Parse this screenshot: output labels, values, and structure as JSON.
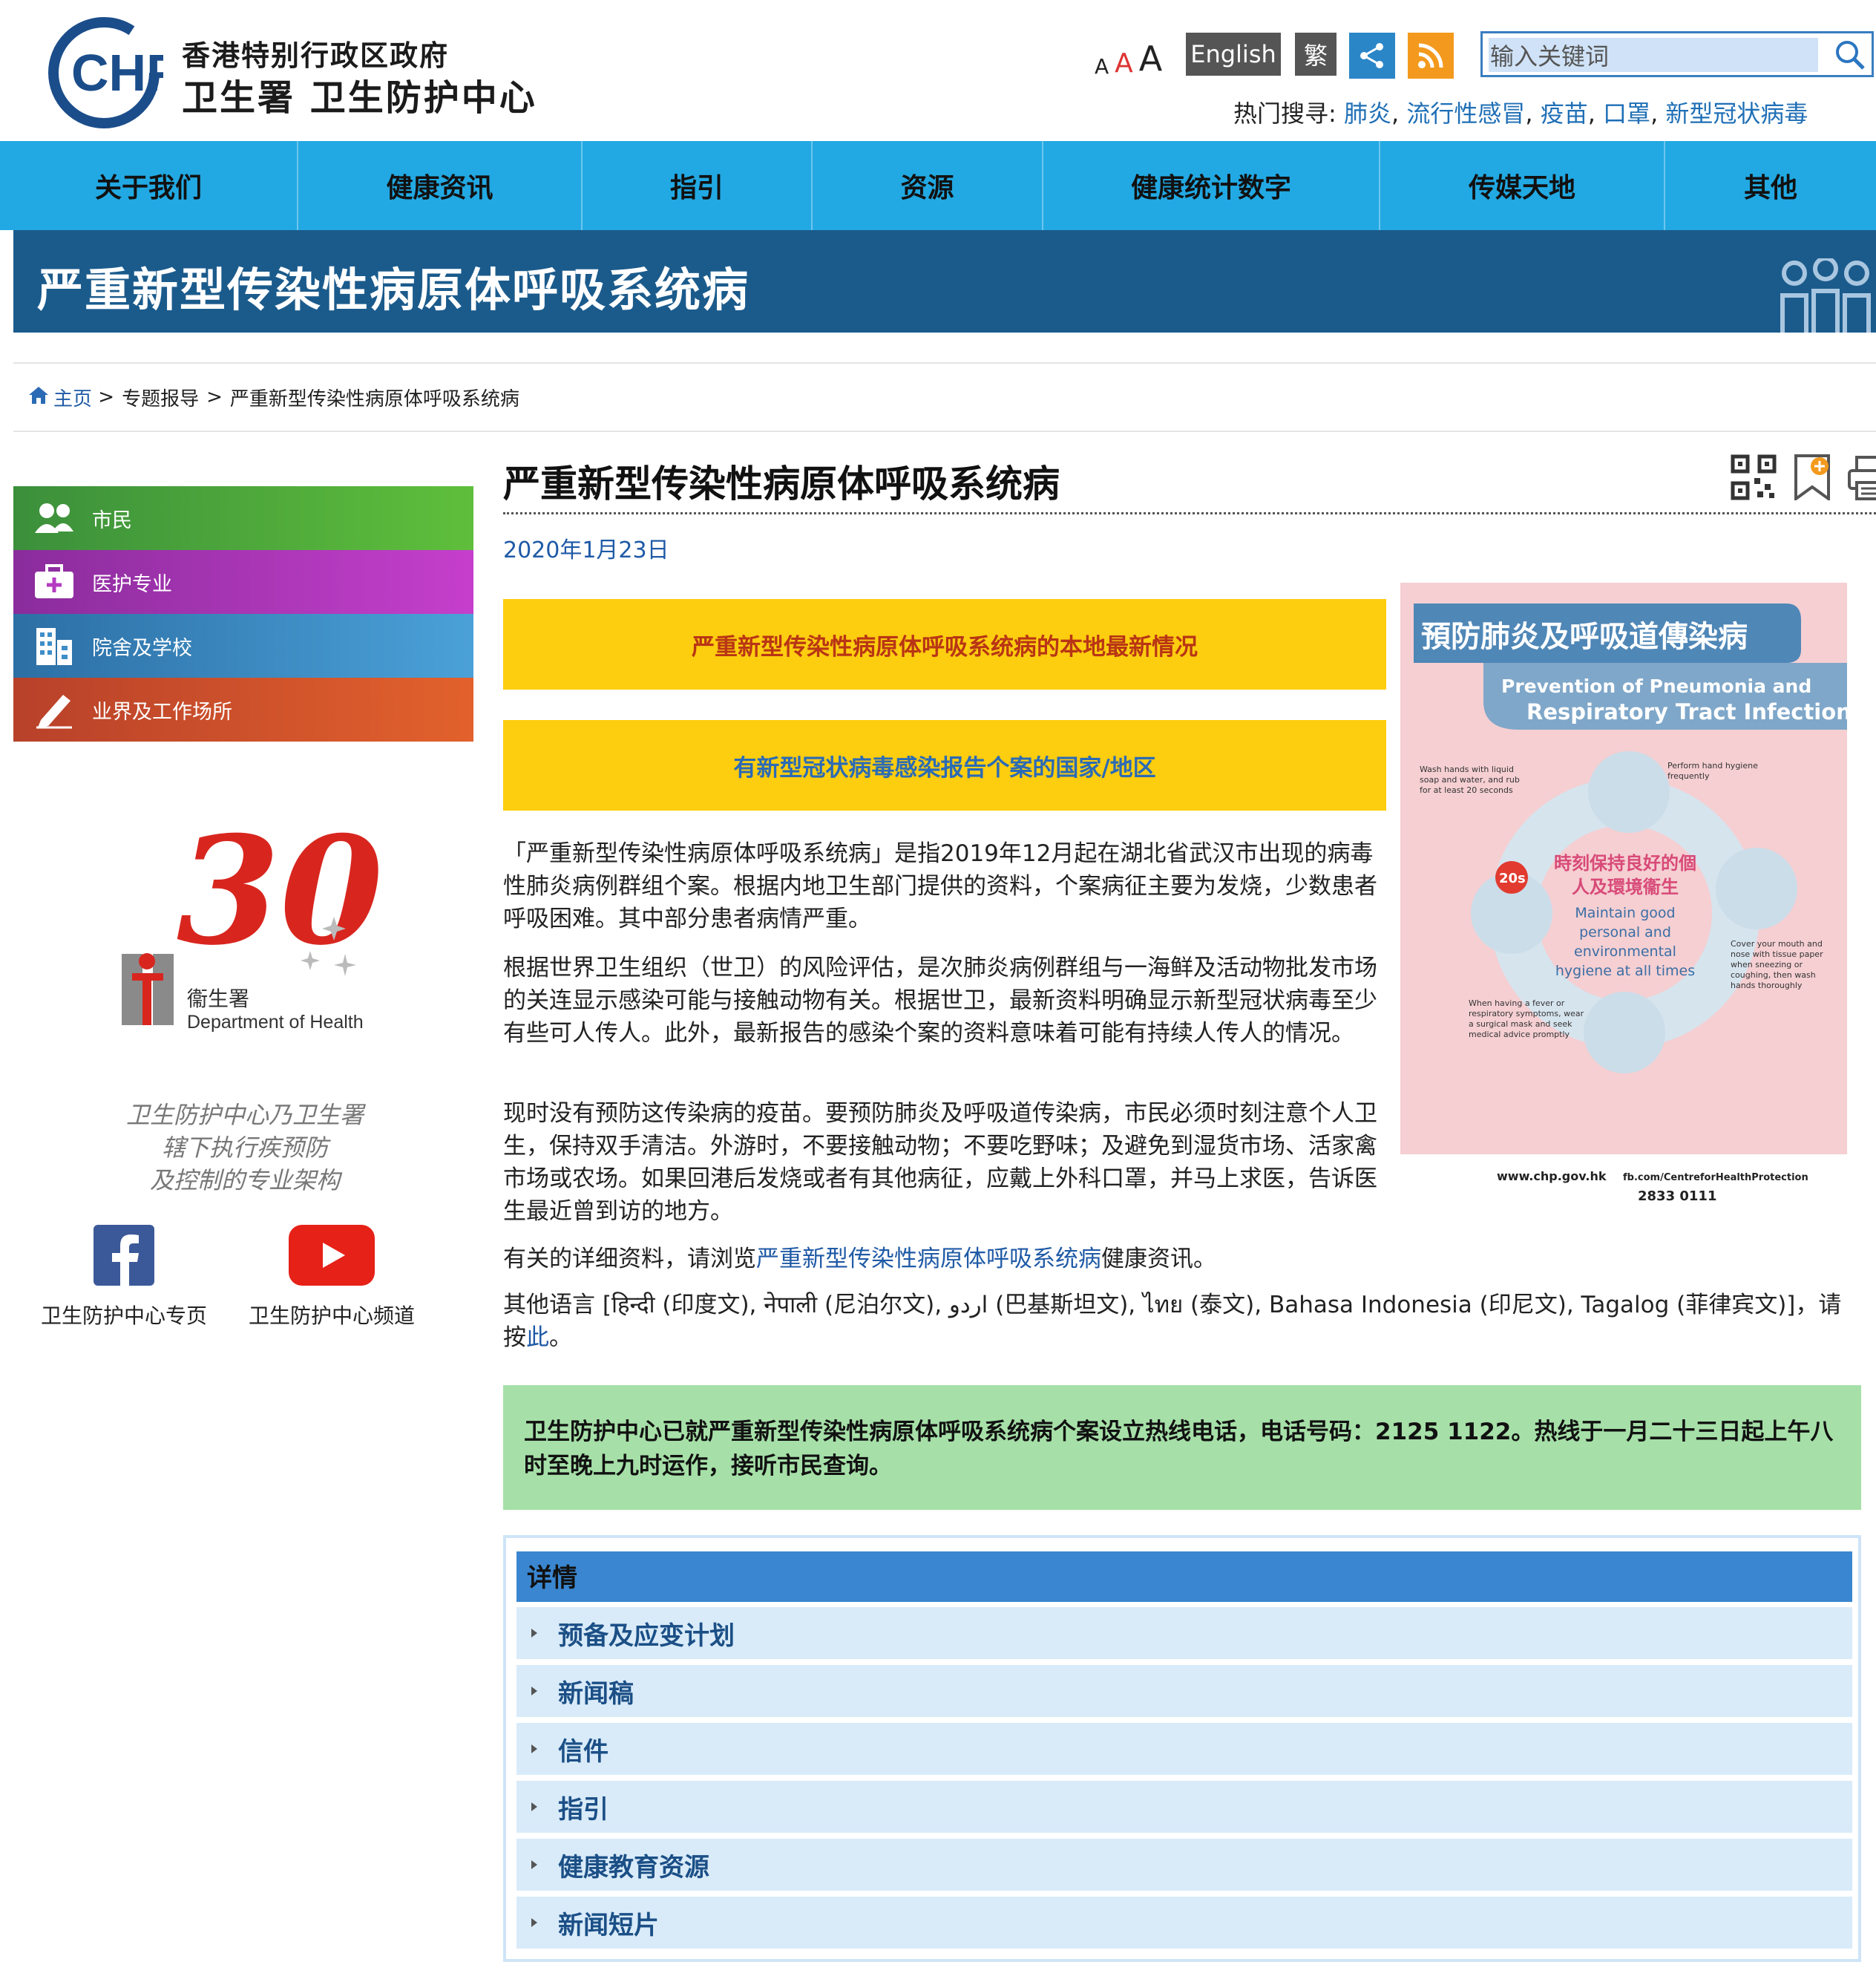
{
  "header": {
    "logo_text": "CHP",
    "org_line1": "香港特别行政区政府",
    "org_line2": "卫生署  卫生防护中心",
    "font_sizes": [
      "A",
      "A",
      "A"
    ],
    "lang_english": "English",
    "lang_traditional": "繁",
    "search_placeholder": "输入关键词",
    "hot_search_label": "热门搜寻:",
    "hot_search_items": [
      "肺炎",
      "流行性感冒",
      "疫苗",
      "口罩",
      "新型冠状病毒"
    ]
  },
  "nav": [
    "关于我们",
    "健康资讯",
    "指引",
    "资源",
    "健康统计数字",
    "传媒天地",
    "其他"
  ],
  "banner": {
    "title": "严重新型传染性病原体呼吸系统病"
  },
  "breadcrumb": [
    "主页",
    "专题报导",
    "严重新型传染性病原体呼吸系统病"
  ],
  "sidebar": {
    "items": [
      {
        "label": "市民",
        "color": "#5aaf3c"
      },
      {
        "label": "医护专业",
        "color": "#b43bc1"
      },
      {
        "label": "院舍及学校",
        "color": "#3e8ec8"
      },
      {
        "label": "业界及工作场所",
        "color": "#d4562a"
      }
    ],
    "anniv_number": "30",
    "anniv_dept_cn": "衞生署",
    "anniv_dept_en": "Department of Health",
    "tagline": [
      "卫生防护中心乃卫生署",
      "辖下执行疾预防",
      "及控制的专业架构"
    ],
    "facebook_label": "卫生防护中心专页",
    "youtube_label": "卫生防护中心频道"
  },
  "main": {
    "title": "严重新型传染性病原体呼吸系统病",
    "date": "2020年1月23日",
    "yellow_buttons": [
      "严重新型传染性病原体呼吸系统病的本地最新情况",
      "有新型冠状病毒感染报告个案的国家/地区"
    ],
    "para1": "「严重新型传染性病原体呼吸系统病」是指2019年12月起在湖北省武汉市出现的病毒性肺炎病例群组个案。根据内地卫生部门提供的资料，个案病征主要为发烧，少数患者呼吸困难。其中部分患者病情严重。",
    "para2": "根据世界卫生组织（世卫）的风险评估，是次肺炎病例群组与一海鲜及活动物批发市场的关连显示感染可能与接触动物有关。根据世卫，最新资料明确显示新型冠状病毒至少有些可人传人。此外，最新报告的感染个案的资料意味着可能有持续人传人的情况。",
    "para3": "现时没有预防这传染病的疫苗。要预防肺炎及呼吸道传染病，市民必须时刻注意个人卫生，保持双手清洁。外游时，不要接触动物；不要吃野味；及避免到湿货市场、活家禽市场或农场。如果回港后发烧或者有其他病征，应戴上外科口罩，并马上求医，告诉医生最近曾到访的地方。",
    "para4_prefix": "有关的详细资料，请浏览",
    "para4_link": "严重新型传染性病原体呼吸系统病",
    "para4_suffix": "健康资讯。",
    "para5_prefix": "其他语言 [हिन्दी (印度文), नेपाली (尼泊尔文), اردو (巴基斯坦文), ไทย (泰文), Bahasa Indonesia (印尼文), Tagalog (菲律宾文)]，请按",
    "para5_link": "此",
    "para5_suffix": "。",
    "hotline": "卫生防护中心已就严重新型传染性病原体呼吸系统病个案设立热线电话，电话号码：2125 1122。热线于一月二十三日起上午八时至晚上九时运作，接听市民查询。",
    "details_header": "详情",
    "details_items": [
      "预备及应变计划",
      "新闻稿",
      "信件",
      "指引",
      "健康教育资源",
      "新闻短片"
    ]
  },
  "poster": {
    "title_cn": "預防肺炎及呼吸道傳染病",
    "title_en_1": "Prevention of Pneumonia and",
    "title_en_2": "Respiratory Tract Infection",
    "center_cn": "時刻保持良好的個人及環境衞生",
    "center_en": "Maintain good personal and environmental hygiene at all times",
    "tip_wash": "Wash hands with liquid soap and water, and rub for at least 20 seconds",
    "tip_hygiene": "Perform hand hygiene frequently",
    "tip_cover": "Cover your mouth and nose with tissue paper when sneezing or coughing, then wash hands thoroughly",
    "tip_fever": "When having a fever or respiratory symptoms, wear a surgical mask and seek medical advice promptly",
    "badge": "20s",
    "site": "www.chp.gov.hk",
    "fb": "fb.com/CentreforHealthProtection",
    "phone": "2833 0111"
  }
}
